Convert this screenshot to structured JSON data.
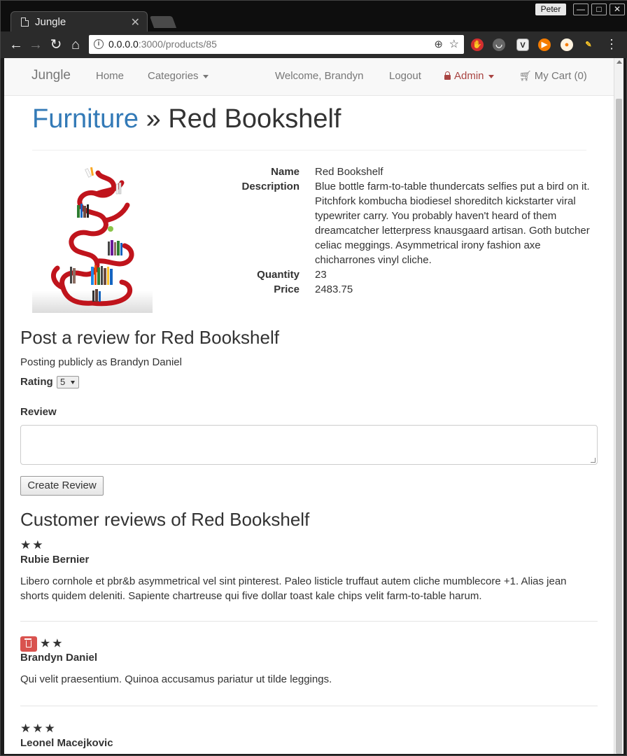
{
  "browser": {
    "tab_title": "Jungle",
    "tab_close": "✕",
    "profile_name": "Peter",
    "url_host": "0.0.0.0",
    "url_path": ":3000/products/85",
    "window_buttons": [
      "—",
      "□",
      "✕"
    ]
  },
  "navbar": {
    "brand": "Jungle",
    "home": "Home",
    "categories": "Categories",
    "welcome": "Welcome, Brandyn",
    "logout": "Logout",
    "admin": "Admin",
    "cart": "My Cart (0)"
  },
  "product": {
    "category": "Furniture",
    "separator": " » ",
    "name": "Red Bookshelf",
    "fields": {
      "name_label": "Name",
      "name_value": "Red Bookshelf",
      "description_label": "Description",
      "description_value": "Blue bottle farm-to-table thundercats selfies put a bird on it. Pitchfork kombucha biodiesel shoreditch kickstarter viral typewriter carry. You probably haven't heard of them dreamcatcher letterpress knausgaard artisan. Goth butcher celiac meggings. Asymmetrical irony fashion axe chicharrones vinyl cliche.",
      "quantity_label": "Quantity",
      "quantity_value": "23",
      "price_label": "Price",
      "price_value": "2483.75"
    }
  },
  "review_form": {
    "heading": "Post a review for Red Bookshelf",
    "posting_as": "Posting publicly as Brandyn Daniel",
    "rating_label": "Rating",
    "rating_value": "5",
    "review_label": "Review",
    "review_value": "",
    "submit_label": "Create Review"
  },
  "reviews": {
    "heading": "Customer reviews of Red Bookshelf",
    "items": [
      {
        "rating": 2,
        "stars": "★★",
        "reviewer": "Rubie Bernier",
        "body": "Libero cornhole et pbr&b asymmetrical vel sint pinterest. Paleo listicle truffaut autem cliche mumblecore +1. Alias jean shorts quidem deleniti. Sapiente chartreuse qui five dollar toast kale chips velit farm-to-table harum.",
        "deletable": false
      },
      {
        "rating": 2,
        "stars": "★★",
        "reviewer": "Brandyn Daniel",
        "body": "Qui velit praesentium. Quinoa accusamus pariatur ut tilde leggings.",
        "deletable": true
      },
      {
        "rating": 3,
        "stars": "★★★",
        "reviewer": "Leonel Macejkovic",
        "body": "",
        "deletable": false
      }
    ]
  },
  "colors": {
    "link": "#337ab7",
    "admin": "#a94442",
    "delete": "#d9534f",
    "bookshelf_red": "#c0141c"
  }
}
